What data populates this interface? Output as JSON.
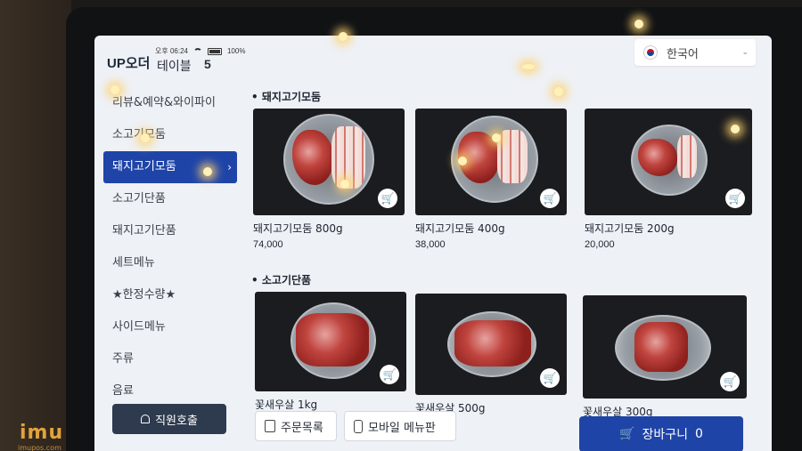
{
  "header": {
    "logo": "UP오더",
    "time": "오후 06:24",
    "battery": "100%",
    "table_label": "테이블",
    "table_number": "5",
    "language": "한국어"
  },
  "sidebar": {
    "items": [
      {
        "label": "리뷰&예약&와이파이"
      },
      {
        "label": "소고기모둠"
      },
      {
        "label": "돼지고기모둠",
        "active": true
      },
      {
        "label": "소고기단품"
      },
      {
        "label": "돼지고기단품"
      },
      {
        "label": "세트메뉴"
      },
      {
        "label": "★한정수량★"
      },
      {
        "label": "사이드메뉴"
      },
      {
        "label": "주류"
      },
      {
        "label": "음료"
      }
    ],
    "call_button": "직원호출"
  },
  "sections": [
    {
      "title": "돼지고기모둠",
      "items": [
        {
          "name": "돼지고기모둠 800g",
          "price": "74,000"
        },
        {
          "name": "돼지고기모둠 400g",
          "price": "38,000"
        },
        {
          "name": "돼지고기모둠 200g",
          "price": "20,000"
        }
      ]
    },
    {
      "title": "소고기단품",
      "items": [
        {
          "name": "꽃새우살 1kg",
          "price": ""
        },
        {
          "name": "꽃새우살 500g",
          "price": ""
        },
        {
          "name": "꽃새우살 300g",
          "price": ""
        }
      ]
    }
  ],
  "bottom": {
    "order_list": "주문목록",
    "mobile_menu": "모바일 메뉴판",
    "cart_label": "장바구니",
    "cart_count": "0"
  },
  "watermark": {
    "brand": "imu",
    "sub": "imupos.com"
  },
  "colors": {
    "primary": "#1f44a8",
    "dark_button": "#2e3a4e",
    "screen_bg": "#eef1f6"
  }
}
